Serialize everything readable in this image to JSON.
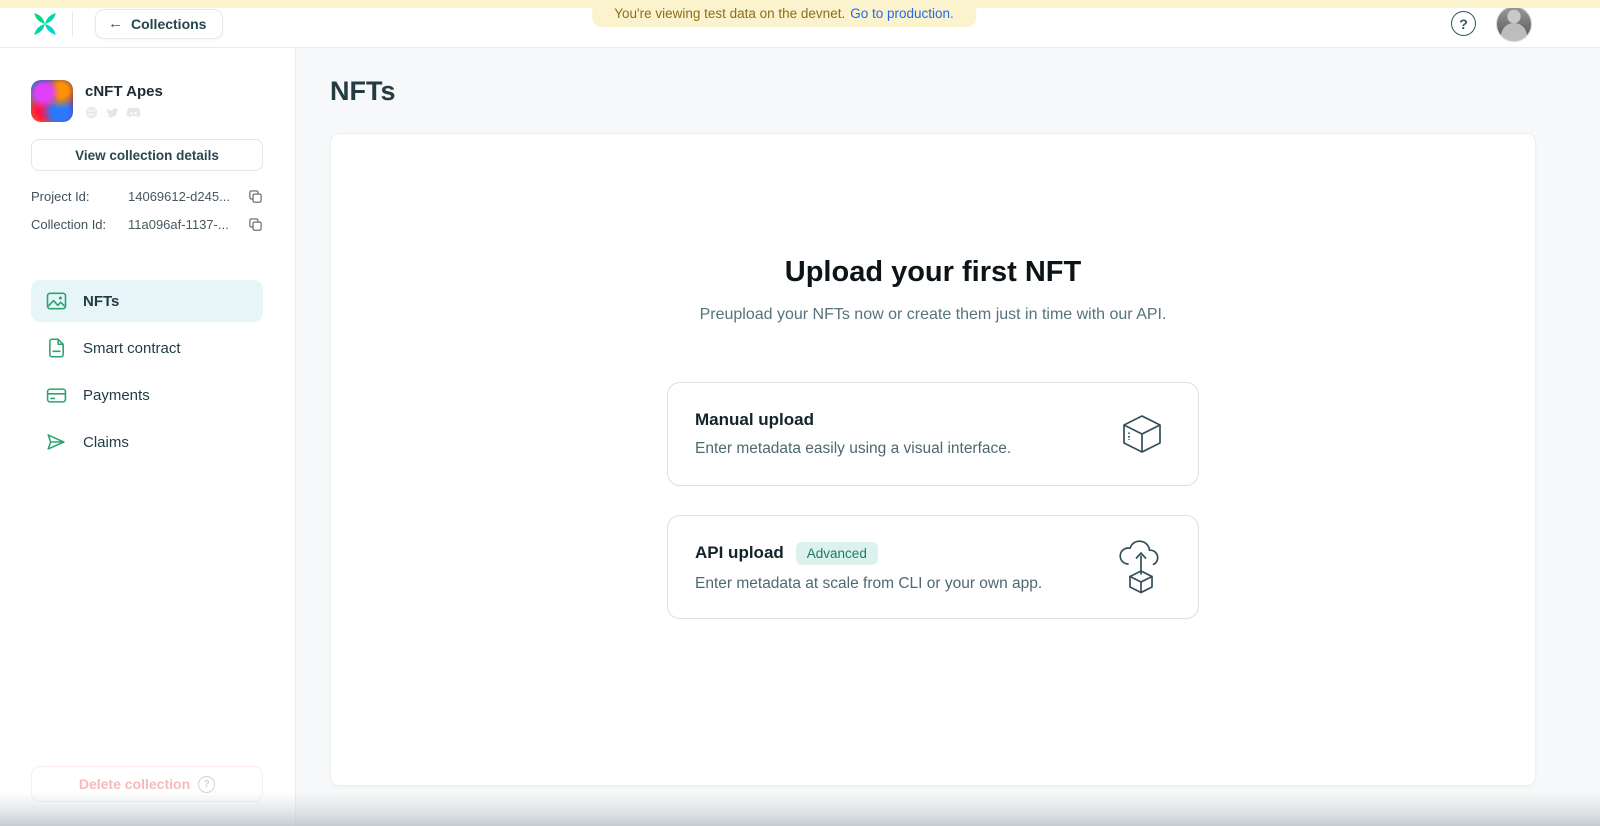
{
  "banner": {
    "message": "You're viewing test data on the devnet.",
    "link_label": "Go to production."
  },
  "header": {
    "back_button_label": "Collections",
    "help_glyph": "?"
  },
  "sidebar": {
    "collection": {
      "name": "cNFT Apes",
      "view_details_label": "View collection details",
      "project_id_label": "Project Id:",
      "project_id_value": "14069612-d245...",
      "collection_id_label": "Collection Id:",
      "collection_id_value": "11a096af-1137-..."
    },
    "nav": [
      {
        "label": "NFTs",
        "icon": "image-icon",
        "active": true
      },
      {
        "label": "Smart contract",
        "icon": "document-icon",
        "active": false
      },
      {
        "label": "Payments",
        "icon": "credit-card-icon",
        "active": false
      },
      {
        "label": "Claims",
        "icon": "send-icon",
        "active": false
      }
    ],
    "delete_button_label": "Delete collection",
    "delete_help_glyph": "?"
  },
  "main": {
    "title": "NFTs",
    "empty_state": {
      "heading": "Upload your first NFT",
      "subheading": "Preupload your NFTs now or create them just in time with our API.",
      "options": [
        {
          "title": "Manual upload",
          "description": "Enter metadata easily using a visual interface.",
          "icon": "cube-icon"
        },
        {
          "title": "API upload",
          "badge": "Advanced",
          "description": "Enter metadata at scale from CLI or your own app.",
          "icon": "cloud-upload-box-icon"
        }
      ]
    }
  },
  "colors": {
    "banner_bg": "#fbf3cd",
    "banner_text": "#8d6e1e",
    "banner_link": "#2368e8",
    "brand_green": "#00dc5f",
    "brand_cyan": "#00d2f5",
    "nav_icon_green": "#2aa571",
    "active_nav_bg": "#e8f5f8",
    "dark_teal_text": "#223c42",
    "badge_bg": "#ddf2ec",
    "badge_text": "#1e7b66",
    "delete_pink": "#f6baba"
  }
}
